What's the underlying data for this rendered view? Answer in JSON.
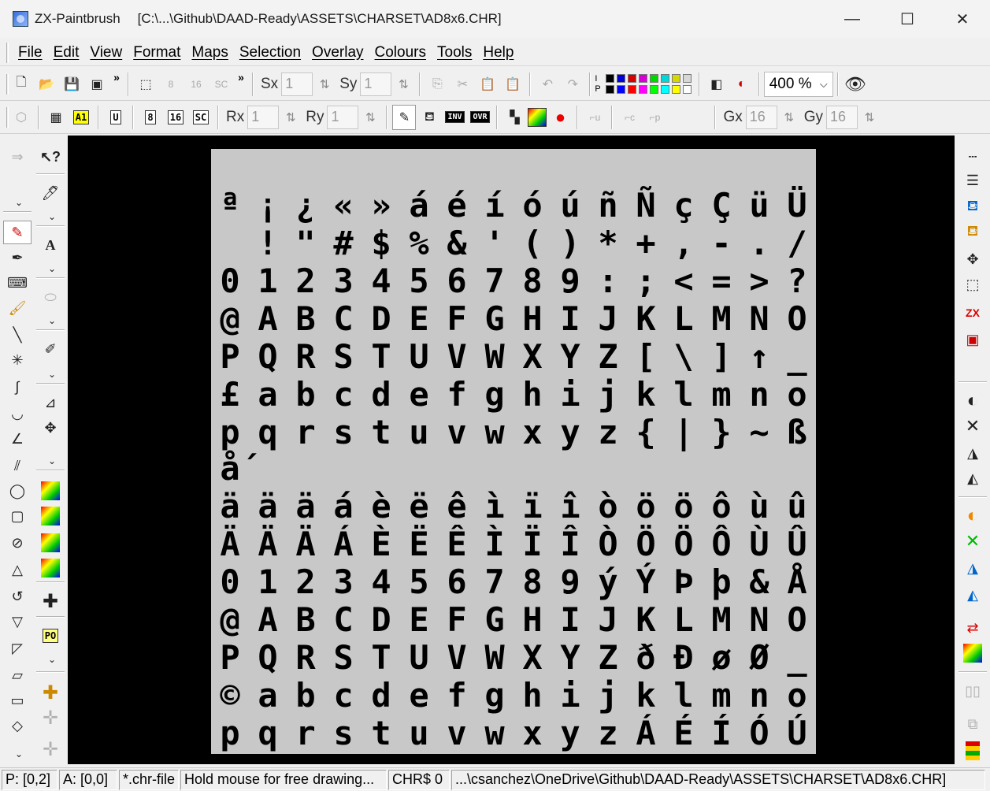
{
  "window": {
    "app_name": "ZX-Paintbrush",
    "file_path": "[C:\\...\\Github\\DAAD-Ready\\ASSETS\\CHARSET\\AD8x6.CHR]",
    "minimize": "—",
    "maximize": "☐",
    "close": "✕"
  },
  "menu": [
    "File",
    "Edit",
    "View",
    "Format",
    "Maps",
    "Selection",
    "Overlay",
    "Colours",
    "Tools",
    "Help"
  ],
  "toolbar1": {
    "sx_label": "Sx",
    "sx_value": "1",
    "sy_label": "Sy",
    "sy_value": "1",
    "ip_label_i": "I",
    "ip_label_p": "P",
    "zoom": "400 %",
    "palette_top": [
      "#000000",
      "#0000d7",
      "#d70000",
      "#d700d7",
      "#00d700",
      "#00d7d7",
      "#d7d700",
      "#d7d7d7"
    ],
    "palette_bottom": [
      "#000000",
      "#0000ff",
      "#ff0000",
      "#ff00ff",
      "#00ff00",
      "#00ffff",
      "#ffff00",
      "#ffffff"
    ]
  },
  "toolbar2": {
    "a1_label": "A1",
    "u_label": "U",
    "b8_label": "8",
    "b16_label": "16",
    "sc_label": "SC",
    "rx_label": "Rx",
    "rx_value": "1",
    "ry_label": "Ry",
    "ry_value": "1",
    "inv_label": "INV",
    "ovr_label": "OVR",
    "gx_label": "Gx",
    "gx_value": "16",
    "gy_label": "Gy",
    "gy_value": "16"
  },
  "lefttools": {
    "po_label": "PO",
    "text_tool": "A"
  },
  "charset_rows": [
    [
      "ª",
      "¡",
      "¿",
      "«",
      "»",
      "á",
      "é",
      "í",
      "ó",
      "ú",
      "ñ",
      "Ñ",
      "ç",
      "Ç",
      "ü",
      "Ü"
    ],
    [
      " ",
      "!",
      "\"",
      "#",
      "$",
      "%",
      "&",
      "'",
      "(",
      ")",
      "*",
      "+",
      ",",
      "-",
      ".",
      "/"
    ],
    [
      "0",
      "1",
      "2",
      "3",
      "4",
      "5",
      "6",
      "7",
      "8",
      "9",
      ":",
      ";",
      "<",
      "=",
      ">",
      "?"
    ],
    [
      "@",
      "A",
      "B",
      "C",
      "D",
      "E",
      "F",
      "G",
      "H",
      "I",
      "J",
      "K",
      "L",
      "M",
      "N",
      "O"
    ],
    [
      "P",
      "Q",
      "R",
      "S",
      "T",
      "U",
      "V",
      "W",
      "X",
      "Y",
      "Z",
      "[",
      "\\",
      "]",
      "↑",
      "_"
    ],
    [
      "£",
      "a",
      "b",
      "c",
      "d",
      "e",
      "f",
      "g",
      "h",
      "i",
      "j",
      "k",
      "l",
      "m",
      "n",
      "o"
    ],
    [
      "p",
      "q",
      "r",
      "s",
      "t",
      "u",
      "v",
      "w",
      "x",
      "y",
      "z",
      "{",
      "|",
      "}",
      "~",
      "ß"
    ],
    [
      "ǻ",
      "",
      "",
      "",
      "",
      "",
      "",
      "",
      "",
      "",
      "",
      "",
      "",
      "",
      "",
      ""
    ],
    [
      "ä",
      "ä",
      "ä",
      "á",
      "è",
      "ë",
      "ê",
      "ì",
      "ï",
      "î",
      "ò",
      "ö",
      "ö",
      "ô",
      "ù",
      "û"
    ],
    [
      "Ä",
      "Ä",
      "Ä",
      "Á",
      "È",
      "Ë",
      "Ê",
      "Ì",
      "Ï",
      "Î",
      "Ò",
      "Ö",
      "Ö",
      "Ô",
      "Ù",
      "Û"
    ],
    [
      "0",
      "1",
      "2",
      "3",
      "4",
      "5",
      "6",
      "7",
      "8",
      "9",
      "ý",
      "Ý",
      "Þ",
      "þ",
      "&",
      "Å"
    ],
    [
      "@",
      "A",
      "B",
      "C",
      "D",
      "E",
      "F",
      "G",
      "H",
      "I",
      "J",
      "K",
      "L",
      "M",
      "N",
      "O"
    ],
    [
      "P",
      "Q",
      "R",
      "S",
      "T",
      "U",
      "V",
      "W",
      "X",
      "Y",
      "Z",
      "ð",
      "Đ",
      "ø",
      "Ø",
      "_"
    ],
    [
      "©",
      "a",
      "b",
      "c",
      "d",
      "e",
      "f",
      "g",
      "h",
      "i",
      "j",
      "k",
      "l",
      "m",
      "n",
      "o"
    ],
    [
      "p",
      "q",
      "r",
      "s",
      "t",
      "u",
      "v",
      "w",
      "x",
      "y",
      "z",
      "Á",
      "É",
      "Í",
      "Ó",
      "Ú"
    ]
  ],
  "status": {
    "pos": "P: [0,2]",
    "attr": "A: [0,0]",
    "filetype": "*.chr-file",
    "hint": "Hold mouse for free drawing...",
    "chr": "CHR$ 0",
    "path": "...\\csanchez\\OneDrive\\Github\\DAAD-Ready\\ASSETS\\CHARSET\\AD8x6.CHR]"
  }
}
